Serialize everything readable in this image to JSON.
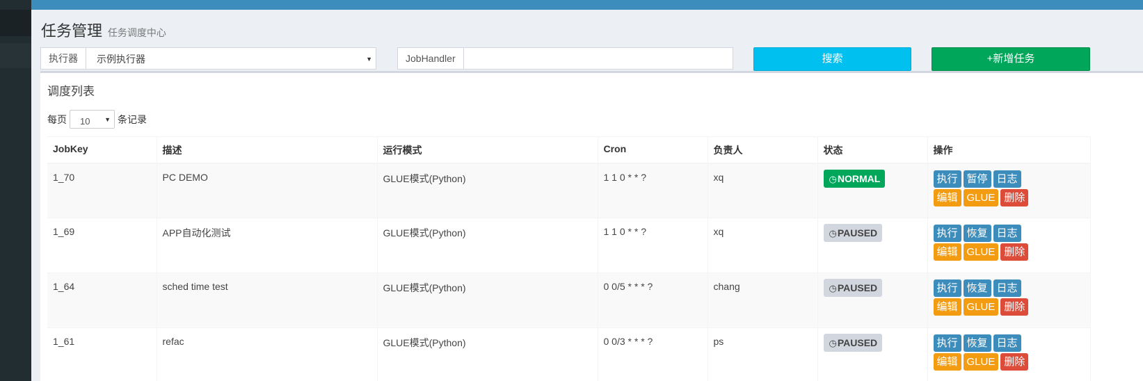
{
  "header": {
    "title": "任务管理",
    "subtitle": "任务调度中心"
  },
  "filters": {
    "executor_label": "执行器",
    "executor_value": "示例执行器",
    "jobhandler_label": "JobHandler",
    "jobhandler_value": "",
    "search_label": "搜索",
    "add_label": "+新增任务"
  },
  "list": {
    "title": "调度列表",
    "page_size_prefix": "每页",
    "page_size_value": "10",
    "page_size_suffix": "条记录",
    "columns": [
      "JobKey",
      "描述",
      "运行模式",
      "Cron",
      "负责人",
      "状态",
      "操作"
    ],
    "rows": [
      {
        "jobkey": "1_70",
        "desc": "PC DEMO",
        "mode": "GLUE模式(Python)",
        "cron": "1 1 0 * * ?",
        "owner": "xq",
        "status": "NORMAL",
        "toggle": "暂停"
      },
      {
        "jobkey": "1_69",
        "desc": "APP自动化测试",
        "mode": "GLUE模式(Python)",
        "cron": "1 1 0 * * ?",
        "owner": "xq",
        "status": "PAUSED",
        "toggle": "恢复"
      },
      {
        "jobkey": "1_64",
        "desc": "sched time test",
        "mode": "GLUE模式(Python)",
        "cron": "0 0/5 * * * ?",
        "owner": "chang",
        "status": "PAUSED",
        "toggle": "恢复"
      },
      {
        "jobkey": "1_61",
        "desc": "refac",
        "mode": "GLUE模式(Python)",
        "cron": "0 0/3 * * * ?",
        "owner": "ps",
        "status": "PAUSED",
        "toggle": "恢复"
      }
    ],
    "actions": {
      "run": "执行",
      "log": "日志",
      "edit": "编辑",
      "glue": "GLUE",
      "delete": "删除"
    }
  },
  "colors": {
    "topbar": "#3c8dbc",
    "sidebar": "#222d32",
    "search_button": "#00c0ef",
    "add_button": "#00a65a",
    "normal_badge": "#00a65a",
    "paused_badge": "#d2d6de",
    "action_blue": "#3c8dbc",
    "action_orange": "#f39c12",
    "action_red": "#dd4b39"
  },
  "icons": {
    "status": "clock-icon",
    "dropdown": "caret-down-icon"
  }
}
